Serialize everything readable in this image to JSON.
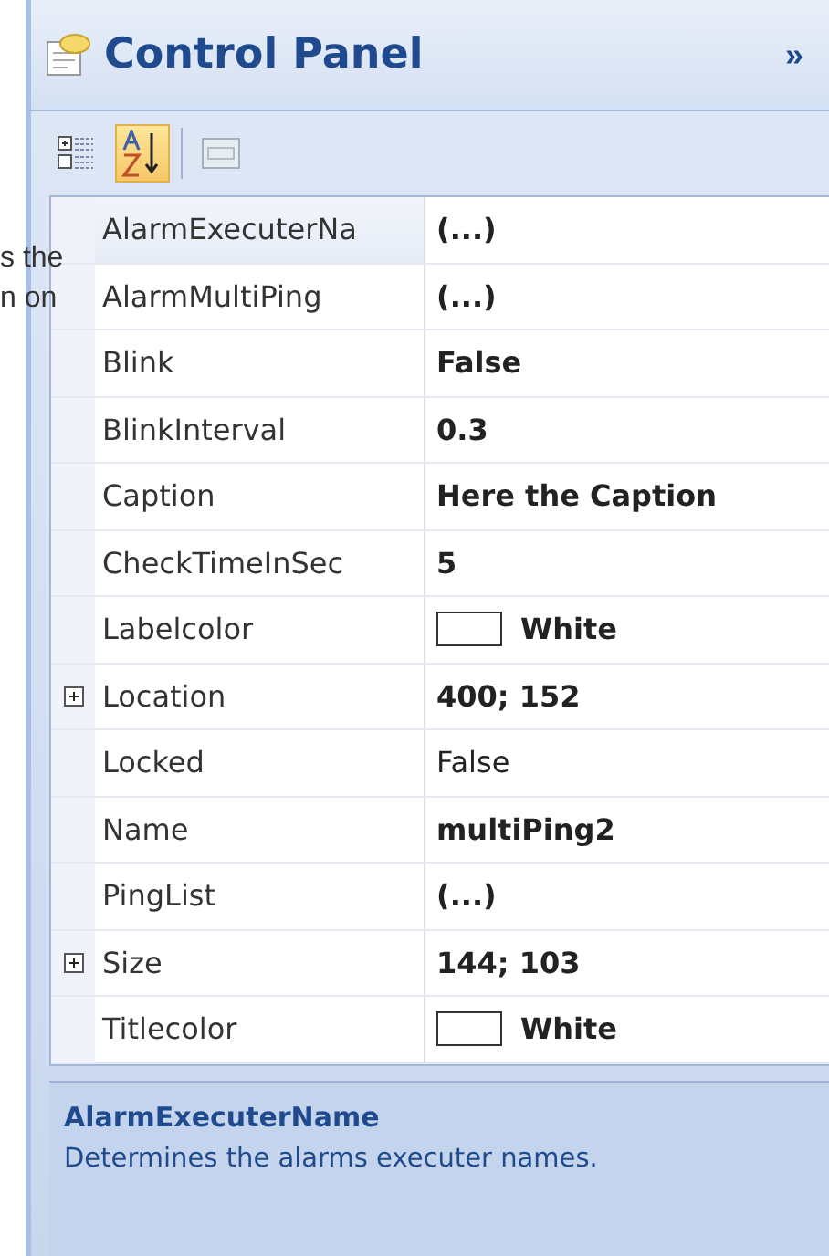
{
  "background_text": [
    "s the",
    "n on"
  ],
  "panel": {
    "title": "Control Panel",
    "collapse": "»"
  },
  "toolbar": [
    {
      "kind": "categorized",
      "selected": false
    },
    {
      "kind": "alphabetical",
      "selected": true
    },
    {
      "kind": "pages",
      "selected": false
    }
  ],
  "properties": [
    {
      "name": "AlarmExecuterNa",
      "value": "(...)",
      "modified": true,
      "expandable": false
    },
    {
      "name": "AlarmMultiPing",
      "value": "(...)",
      "modified": true,
      "expandable": false
    },
    {
      "name": "Blink",
      "value": "False",
      "modified": true,
      "expandable": false
    },
    {
      "name": "BlinkInterval",
      "value": "0.3",
      "modified": true,
      "expandable": false
    },
    {
      "name": "Caption",
      "value": "Here the Caption",
      "modified": true,
      "expandable": false
    },
    {
      "name": "CheckTimeInSec",
      "value": "5",
      "modified": true,
      "expandable": false
    },
    {
      "name": "Labelcolor",
      "value": "White",
      "modified": true,
      "expandable": false,
      "color": "#ffffff"
    },
    {
      "name": "Location",
      "value": "400; 152",
      "modified": true,
      "expandable": true
    },
    {
      "name": "Locked",
      "value": "False",
      "modified": false,
      "expandable": false
    },
    {
      "name": "Name",
      "value": "multiPing2",
      "modified": true,
      "expandable": false
    },
    {
      "name": "PingList",
      "value": "(...)",
      "modified": true,
      "expandable": false
    },
    {
      "name": "Size",
      "value": "144; 103",
      "modified": true,
      "expandable": true
    },
    {
      "name": "Titlecolor",
      "value": "White",
      "modified": true,
      "expandable": false,
      "color": "#ffffff"
    }
  ],
  "description": {
    "title": "AlarmExecuterName",
    "text": "Determines the alarms executer names."
  }
}
